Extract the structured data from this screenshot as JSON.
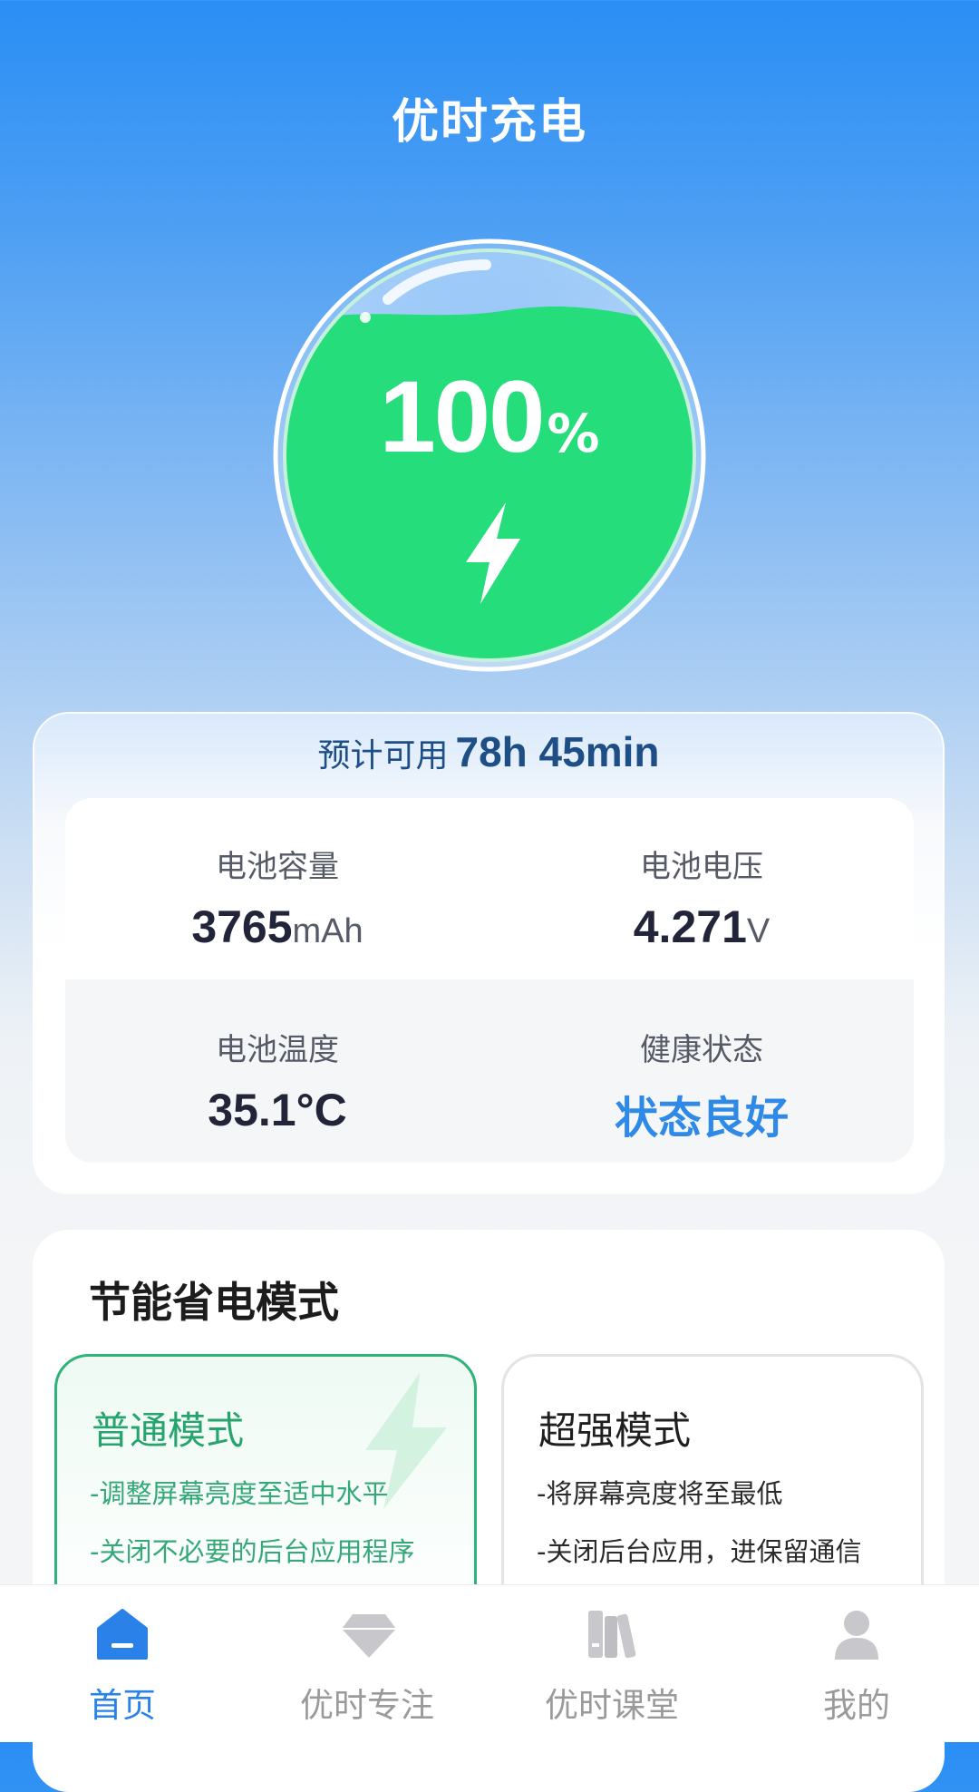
{
  "header": {
    "title": "优时充电"
  },
  "battery": {
    "percent": "100",
    "unit": "%"
  },
  "estimate": {
    "label": "预计可用",
    "value": "78h 45min"
  },
  "stats": {
    "capacity": {
      "label": "电池容量",
      "value": "3765",
      "unit": "mAh"
    },
    "voltage": {
      "label": "电池电压",
      "value": "4.271",
      "unit": "V"
    },
    "temperature": {
      "label": "电池温度",
      "value": "35.1°C"
    },
    "health": {
      "label": "健康状态",
      "value": "状态良好"
    }
  },
  "modes": {
    "title": "节能省电模式",
    "normal": {
      "name": "普通模式",
      "lines": [
        "-调整屏幕亮度至适中水平",
        "-关闭不必要的后台应用程序"
      ]
    },
    "super": {
      "name": "超强模式",
      "lines": [
        "-将屏幕亮度将至最低",
        "-关闭后台应用，进保留通信"
      ]
    }
  },
  "nav": {
    "items": [
      {
        "label": "首页",
        "icon": "home-icon",
        "active": true
      },
      {
        "label": "优时专注",
        "icon": "diamond-icon",
        "active": false
      },
      {
        "label": "优时课堂",
        "icon": "books-icon",
        "active": false
      },
      {
        "label": "我的",
        "icon": "person-icon",
        "active": false
      }
    ]
  },
  "colors": {
    "accent": "#2a82e8",
    "battery_green": "#25dd7a",
    "mode_green": "#27a36e"
  }
}
